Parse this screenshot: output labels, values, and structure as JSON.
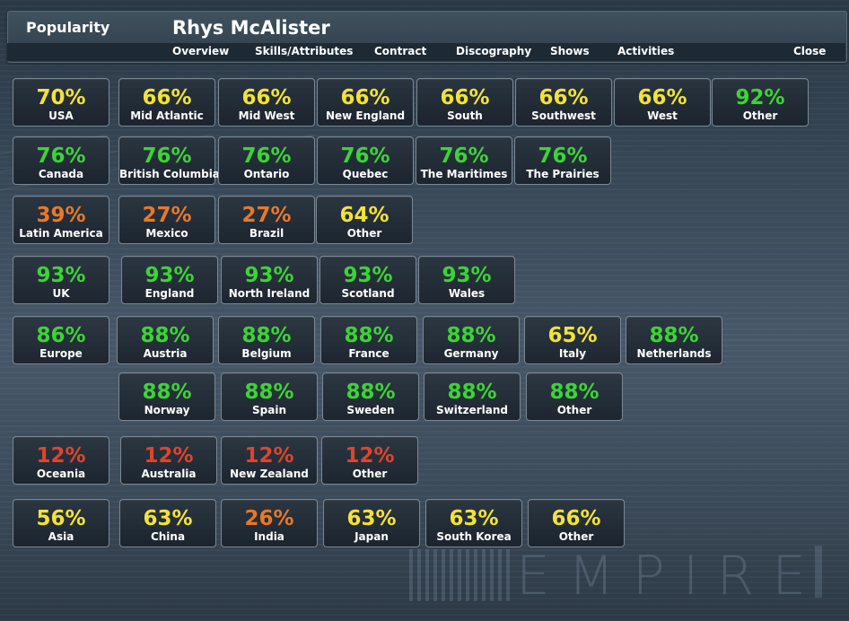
{
  "header": {
    "section_title": "Popularity",
    "artist_name": "Rhys McAlister"
  },
  "nav": {
    "overview": "Overview",
    "skills": "Skills/Attributes",
    "contract": "Contract",
    "discography": "Discography",
    "shows": "Shows",
    "activities": "Activities",
    "close": "Close"
  },
  "watermark": "EMPIRE",
  "colors": {
    "yellow": "#f2e23a",
    "green": "#3cd436",
    "orange": "#e8782a",
    "red": "#e0442a"
  },
  "regions": {
    "usa": [
      {
        "pct": "70%",
        "label": "USA",
        "color": "yellow"
      },
      {
        "pct": "66%",
        "label": "Mid Atlantic",
        "color": "yellow"
      },
      {
        "pct": "66%",
        "label": "Mid West",
        "color": "yellow"
      },
      {
        "pct": "66%",
        "label": "New England",
        "color": "yellow"
      },
      {
        "pct": "66%",
        "label": "South",
        "color": "yellow"
      },
      {
        "pct": "66%",
        "label": "Southwest",
        "color": "yellow"
      },
      {
        "pct": "66%",
        "label": "West",
        "color": "yellow"
      },
      {
        "pct": "92%",
        "label": "Other",
        "color": "green"
      }
    ],
    "canada": [
      {
        "pct": "76%",
        "label": "Canada",
        "color": "green"
      },
      {
        "pct": "76%",
        "label": "British Columbia",
        "color": "green"
      },
      {
        "pct": "76%",
        "label": "Ontario",
        "color": "green"
      },
      {
        "pct": "76%",
        "label": "Quebec",
        "color": "green"
      },
      {
        "pct": "76%",
        "label": "The Maritimes",
        "color": "green"
      },
      {
        "pct": "76%",
        "label": "The Prairies",
        "color": "green"
      }
    ],
    "latin_america": [
      {
        "pct": "39%",
        "label": "Latin America",
        "color": "orange"
      },
      {
        "pct": "27%",
        "label": "Mexico",
        "color": "orange"
      },
      {
        "pct": "27%",
        "label": "Brazil",
        "color": "orange"
      },
      {
        "pct": "64%",
        "label": "Other",
        "color": "yellow"
      }
    ],
    "uk": [
      {
        "pct": "93%",
        "label": "UK",
        "color": "green"
      },
      {
        "pct": "93%",
        "label": "England",
        "color": "green"
      },
      {
        "pct": "93%",
        "label": "North Ireland",
        "color": "green"
      },
      {
        "pct": "93%",
        "label": "Scotland",
        "color": "green"
      },
      {
        "pct": "93%",
        "label": "Wales",
        "color": "green"
      }
    ],
    "europe": [
      {
        "pct": "86%",
        "label": "Europe",
        "color": "green"
      },
      {
        "pct": "88%",
        "label": "Austria",
        "color": "green"
      },
      {
        "pct": "88%",
        "label": "Belgium",
        "color": "green"
      },
      {
        "pct": "88%",
        "label": "France",
        "color": "green"
      },
      {
        "pct": "88%",
        "label": "Germany",
        "color": "green"
      },
      {
        "pct": "65%",
        "label": "Italy",
        "color": "yellow"
      },
      {
        "pct": "88%",
        "label": "Netherlands",
        "color": "green"
      },
      {
        "pct": "88%",
        "label": "Norway",
        "color": "green"
      },
      {
        "pct": "88%",
        "label": "Spain",
        "color": "green"
      },
      {
        "pct": "88%",
        "label": "Sweden",
        "color": "green"
      },
      {
        "pct": "88%",
        "label": "Switzerland",
        "color": "green"
      },
      {
        "pct": "88%",
        "label": "Other",
        "color": "green"
      }
    ],
    "oceania": [
      {
        "pct": "12%",
        "label": "Oceania",
        "color": "red"
      },
      {
        "pct": "12%",
        "label": "Australia",
        "color": "red"
      },
      {
        "pct": "12%",
        "label": "New Zealand",
        "color": "red"
      },
      {
        "pct": "12%",
        "label": "Other",
        "color": "red"
      }
    ],
    "asia": [
      {
        "pct": "56%",
        "label": "Asia",
        "color": "yellow"
      },
      {
        "pct": "63%",
        "label": "China",
        "color": "yellow"
      },
      {
        "pct": "26%",
        "label": "India",
        "color": "orange"
      },
      {
        "pct": "63%",
        "label": "Japan",
        "color": "yellow"
      },
      {
        "pct": "63%",
        "label": "South Korea",
        "color": "yellow"
      },
      {
        "pct": "66%",
        "label": "Other",
        "color": "yellow"
      }
    ]
  }
}
